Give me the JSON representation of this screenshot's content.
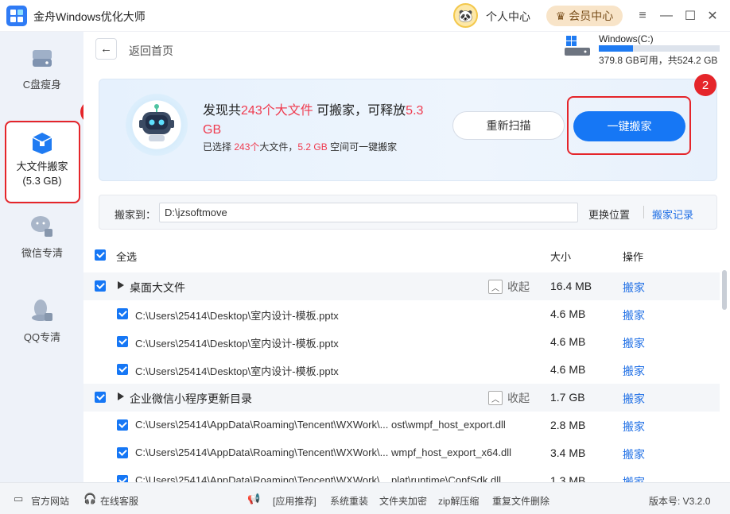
{
  "app": {
    "title": "金舟Windows优化大师"
  },
  "titlebar": {
    "user_center": "个人中心",
    "vip": "会员中心"
  },
  "sidebar": {
    "items": [
      {
        "label": "C盘瘦身"
      },
      {
        "label": "大文件搬家",
        "sub": "(5.3 GB)"
      },
      {
        "label": "微信专清"
      },
      {
        "label": "QQ专清"
      }
    ]
  },
  "badges": {
    "one": "1",
    "two": "2"
  },
  "nav": {
    "back": "返回首页"
  },
  "drive": {
    "name": "Windows(C:)",
    "free_text": "379.8 GB可用，共524.2 GB",
    "used_ratio": 0.28
  },
  "banner": {
    "pre": "发现共",
    "count": "243个大文件",
    "mid": " 可搬家，可释放",
    "size": "5.3",
    "size_unit": "GB",
    "sub_pre": "已选择 ",
    "sub_count": "243个",
    "sub_mid": "大文件，",
    "sub_size": "5.2 GB",
    "sub_post": " 空间可一键搬家",
    "rescan": "重新扫描",
    "one_click": "一键搬家"
  },
  "path": {
    "label": "搬家到：",
    "value": "D:\\jzsoftmove",
    "change": "更换位置",
    "log": "搬家记录"
  },
  "list": {
    "select_all": "全选",
    "col_size": "大小",
    "col_op": "操作",
    "rows": [
      {
        "type": "group",
        "name": "桌面大文件",
        "collapse": "收起",
        "size": "16.4 MB",
        "op": "搬家"
      },
      {
        "type": "file",
        "name": "C:\\Users\\25414\\Desktop\\室内设计-模板.pptx",
        "size": "4.6 MB",
        "op": "搬家"
      },
      {
        "type": "file",
        "name": "C:\\Users\\25414\\Desktop\\室内设计-模板.pptx",
        "size": "4.6 MB",
        "op": "搬家"
      },
      {
        "type": "file",
        "name": "C:\\Users\\25414\\Desktop\\室内设计-模板.pptx",
        "size": "4.6 MB",
        "op": "搬家"
      },
      {
        "type": "group",
        "name": "企业微信小程序更新目录",
        "collapse": "收起",
        "size": "1.7 GB",
        "op": "搬家"
      },
      {
        "type": "file",
        "name": "C:\\Users\\25414\\AppData\\Roaming\\Tencent\\WXWork\\...   ost\\wmpf_host_export.dll",
        "size": "2.8 MB",
        "op": "搬家"
      },
      {
        "type": "file",
        "name": "C:\\Users\\25414\\AppData\\Roaming\\Tencent\\WXWork\\...  wmpf_host_export_x64.dll",
        "size": "3.4 MB",
        "op": "搬家"
      },
      {
        "type": "file",
        "name": "C:\\Users\\25414\\AppData\\Roaming\\Tencent\\WXWork\\...  plat\\runtime\\ConfSdk.dll",
        "size": "1.3 MB",
        "op": "搬家"
      }
    ]
  },
  "footer": {
    "website": "官方网站",
    "support": "在线客服",
    "recommend": "[应用推荐]",
    "links": [
      "系统重装",
      "文件夹加密",
      "zip解压缩",
      "重复文件删除"
    ],
    "version": "版本号: V3.2.0"
  }
}
